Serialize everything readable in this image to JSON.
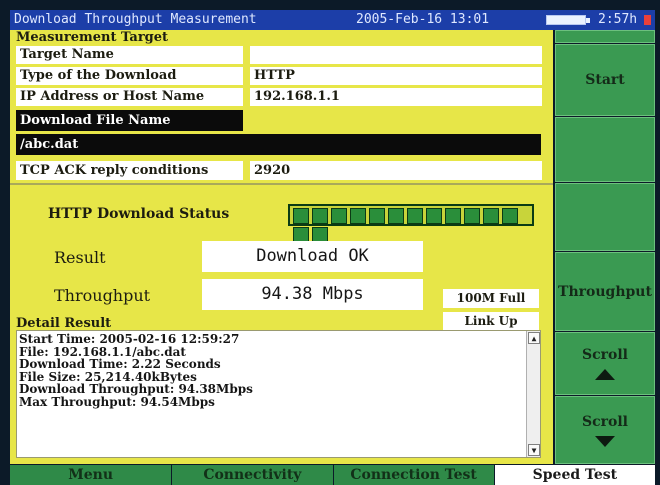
{
  "titlebar": {
    "title": "Download Throughput Measurement",
    "datetime": "2005-Feb-16 13:01",
    "battery_time": "2:57h"
  },
  "target": {
    "section_label": "Measurement Target",
    "rows": [
      {
        "label": "Target Name",
        "value": ""
      },
      {
        "label": "Type of the Download",
        "value": "HTTP"
      },
      {
        "label": "IP Address or Host Name",
        "value": "192.168.1.1"
      },
      {
        "label": "Download File Name",
        "value": ""
      },
      {
        "label": "/abc.dat",
        "value": ""
      },
      {
        "label": "TCP ACK reply conditions",
        "value": "2920"
      }
    ]
  },
  "status": {
    "label": "HTTP Download Status",
    "progress": 1.0,
    "segments": 14,
    "result_label": "Result",
    "result_value": "Download OK",
    "throughput_label": "Throughput",
    "throughput_value": "94.38 Mbps",
    "link_speed": "100M Full",
    "link_state": "Link Up"
  },
  "detail": {
    "label": "Detail Result",
    "lines": [
      "Start Time: 2005-02-16 12:59:27",
      "File: 192.168.1.1/abc.dat",
      "Download Time: 2.22 Seconds",
      "File Size: 25,214.40kBytes",
      "Download Throughput: 94.38Mbps",
      "Max Throughput: 94.54Mbps"
    ]
  },
  "side_buttons": [
    {
      "label": ""
    },
    {
      "label": "Start"
    },
    {
      "label": ""
    },
    {
      "label": ""
    },
    {
      "label": "Throughput"
    },
    {
      "label": "Scroll",
      "icon": "triangle-up-icon"
    },
    {
      "label": "Scroll",
      "icon": "triangle-down-icon"
    }
  ],
  "tabs": [
    {
      "label": "Menu",
      "active": false
    },
    {
      "label": "Connectivity",
      "active": false
    },
    {
      "label": "Connection Test",
      "active": false
    },
    {
      "label": "Speed Test",
      "active": true
    }
  ],
  "colors": {
    "panel": "#e7e648",
    "button": "#3a9a52",
    "titlebar": "#1c3ea8",
    "progress": "#2a8e3a"
  }
}
